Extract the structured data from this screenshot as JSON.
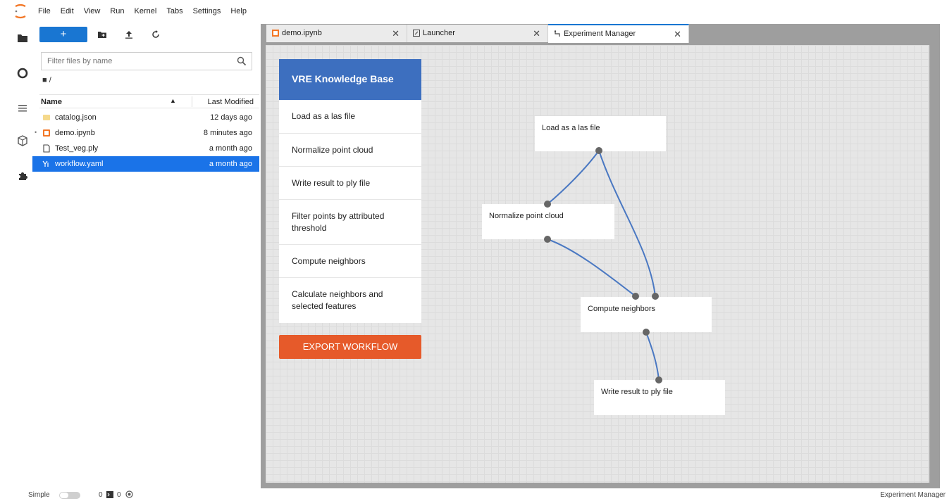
{
  "menu": [
    "File",
    "Edit",
    "View",
    "Run",
    "Kernel",
    "Tabs",
    "Settings",
    "Help"
  ],
  "filebrowser": {
    "new_label": "+",
    "filter_placeholder": "Filter files by name",
    "breadcrumb": "■ /",
    "col_name": "Name",
    "col_modified": "Last Modified",
    "sort_indicator": "▲",
    "files": [
      {
        "name": "catalog.json",
        "modified": "12 days ago",
        "icon": "json-file-icon"
      },
      {
        "name": "demo.ipynb",
        "modified": "8 minutes ago",
        "icon": "notebook-icon"
      },
      {
        "name": "Test_veg.ply",
        "modified": "a month ago",
        "icon": "file-icon"
      },
      {
        "name": "workflow.yaml",
        "modified": "a month ago",
        "icon": "yaml-file-icon"
      }
    ]
  },
  "tabs": [
    {
      "label": "demo.ipynb",
      "icon": "notebook-icon",
      "close": "✕"
    },
    {
      "label": "Launcher",
      "icon": "launcher-icon",
      "close": "✕"
    },
    {
      "label": "Experiment Manager",
      "icon": "experiment-icon",
      "close": "✕"
    }
  ],
  "kb": {
    "title": "VRE Knowledge Base",
    "items": [
      "Load as a las file",
      "Normalize point cloud",
      "Write result to ply file",
      "Filter points by attributed threshold",
      "Compute neighbors",
      "Calculate neighbors and selected features"
    ],
    "export_label": "EXPORT WORKFLOW"
  },
  "workflow": {
    "nodes": [
      {
        "label": "Load as a las file"
      },
      {
        "label": "Normalize point cloud"
      },
      {
        "label": "Compute neighbors"
      },
      {
        "label": "Write result to ply file"
      }
    ]
  },
  "status": {
    "mode_label": "Simple",
    "count_a": "0",
    "count_b": "0",
    "right_label": "Experiment Manager"
  },
  "colors": {
    "accent": "#1976d2",
    "kb_header": "#3d6fbf",
    "export": "#e65a2a",
    "edge": "#4a78c2"
  }
}
